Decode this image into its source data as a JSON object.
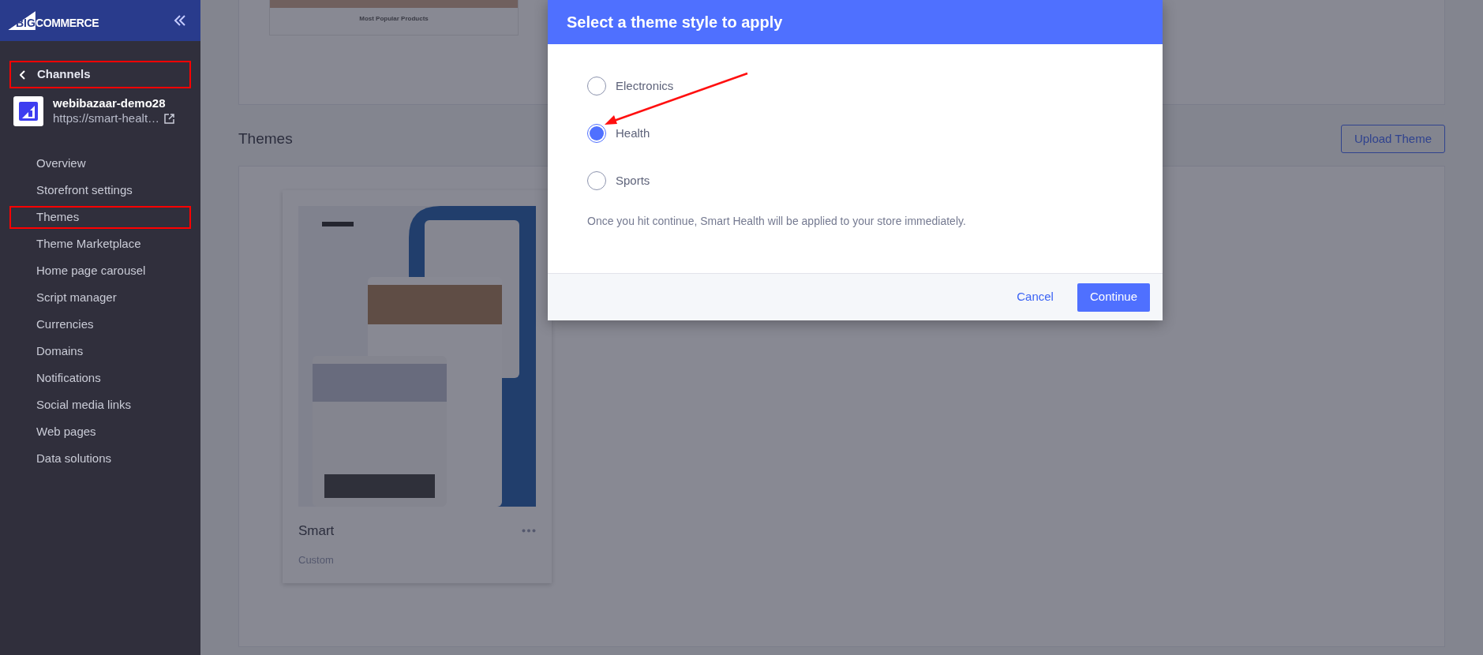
{
  "sidebar": {
    "logo": {
      "mark": "BIG",
      "word": "COMMERCE"
    },
    "back_link": {
      "label": "Channels",
      "annotated": true
    },
    "store": {
      "name": "webibazaar-demo28",
      "url": "https://smart-healt…"
    },
    "items": [
      {
        "label": "Overview",
        "annotated": false
      },
      {
        "label": "Storefront settings",
        "annotated": false
      },
      {
        "label": "Themes",
        "annotated": true
      },
      {
        "label": "Theme Marketplace",
        "annotated": false
      },
      {
        "label": "Home page carousel",
        "annotated": false
      },
      {
        "label": "Script manager",
        "annotated": false
      },
      {
        "label": "Currencies",
        "annotated": false
      },
      {
        "label": "Domains",
        "annotated": false
      },
      {
        "label": "Notifications",
        "annotated": false
      },
      {
        "label": "Social media links",
        "annotated": false
      },
      {
        "label": "Web pages",
        "annotated": false
      },
      {
        "label": "Data solutions",
        "annotated": false
      }
    ]
  },
  "preview": {
    "section_title": "Most Popular Products"
  },
  "themes": {
    "title": "Themes",
    "upload_button": "Upload Theme",
    "cards": [
      {
        "name": "Smart",
        "type": "Custom"
      }
    ]
  },
  "dialog": {
    "title": "Select a theme style to apply",
    "options": [
      {
        "label": "Electronics",
        "selected": false
      },
      {
        "label": "Health",
        "selected": true
      },
      {
        "label": "Sports",
        "selected": false
      }
    ],
    "note": "Once you hit continue, Smart Health will be applied to your store immediately.",
    "cancel": "Cancel",
    "confirm": "Continue"
  }
}
